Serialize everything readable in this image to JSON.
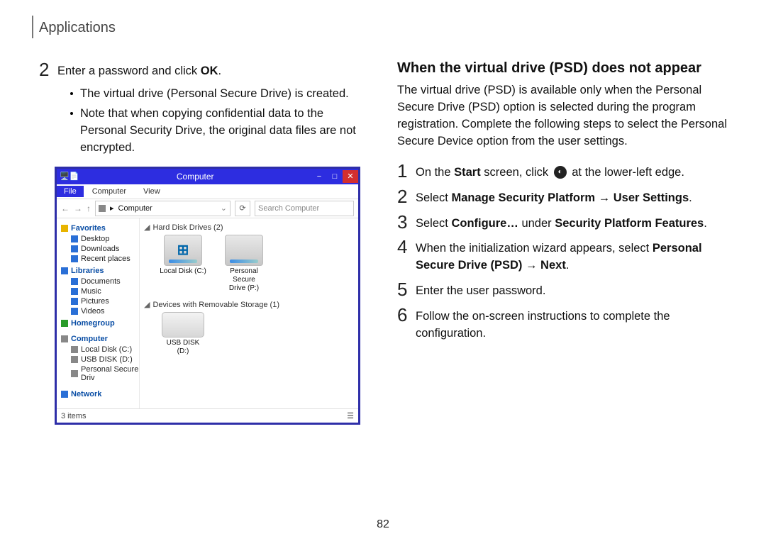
{
  "header": {
    "title": "Applications"
  },
  "left": {
    "step2": {
      "num": "2",
      "text_a": "Enter a password and click ",
      "ok": "OK",
      "dot": "."
    },
    "bullets": [
      "The virtual drive (Personal Secure Drive) is created.",
      "Note that when copying confidential data to the Personal Security Drive, the original data files are not encrypted."
    ]
  },
  "screenshot": {
    "titlebar": {
      "title": "Computer"
    },
    "menutabs": {
      "file": "File",
      "computer": "Computer",
      "view": "View"
    },
    "addr": {
      "back": "←",
      "fwd": "→",
      "up": "↑",
      "path_label": "Computer",
      "chev": "▸",
      "refresh": "⟳",
      "search_placeholder": "Search Computer"
    },
    "side": {
      "favorites": {
        "label": "Favorites",
        "items": [
          "Desktop",
          "Downloads",
          "Recent places"
        ]
      },
      "libraries": {
        "label": "Libraries",
        "items": [
          "Documents",
          "Music",
          "Pictures",
          "Videos"
        ]
      },
      "homegroup": {
        "label": "Homegroup"
      },
      "computer": {
        "label": "Computer",
        "items": [
          "Local Disk (C:)",
          "USB DISK (D:)",
          "Personal Secure Driv"
        ]
      },
      "network": {
        "label": "Network"
      }
    },
    "main": {
      "sec1": "Hard Disk Drives (2)",
      "sec2": "Devices with Removable Storage (1)",
      "drive1": "Local Disk (C:)",
      "drive2_a": "Personal Secure",
      "drive2_b": "Drive (P:)",
      "usb": "USB DISK (D:)"
    },
    "status": {
      "left": "3 items",
      "right": ""
    }
  },
  "right": {
    "title": "When the virtual drive (PSD) does not appear",
    "para": "The virtual drive (PSD) is available only when the Personal Secure Drive (PSD) option is selected during the program registration. Complete the following steps to select the Personal Secure Device option from the user settings.",
    "s1": {
      "num": "1",
      "a": "On the ",
      "b": "Start",
      "c": " screen, click ",
      "icon": "◐",
      "d": " at the lower-left edge."
    },
    "s2": {
      "num": "2",
      "a": "Select ",
      "b": "Manage Security Platform → User Settings",
      "c": "."
    },
    "s3": {
      "num": "3",
      "a": "Select ",
      "b": "Configure…",
      "c": " under ",
      "d": "Security Platform Features",
      "e": "."
    },
    "s4": {
      "num": "4",
      "a": "When the initialization wizard appears, select ",
      "b": "Personal Secure Drive (PSD) → Next",
      "c": "."
    },
    "s5": {
      "num": "5",
      "a": "Enter the user password."
    },
    "s6": {
      "num": "6",
      "a": "Follow the on-screen instructions to complete the configuration."
    }
  },
  "page_number": "82"
}
